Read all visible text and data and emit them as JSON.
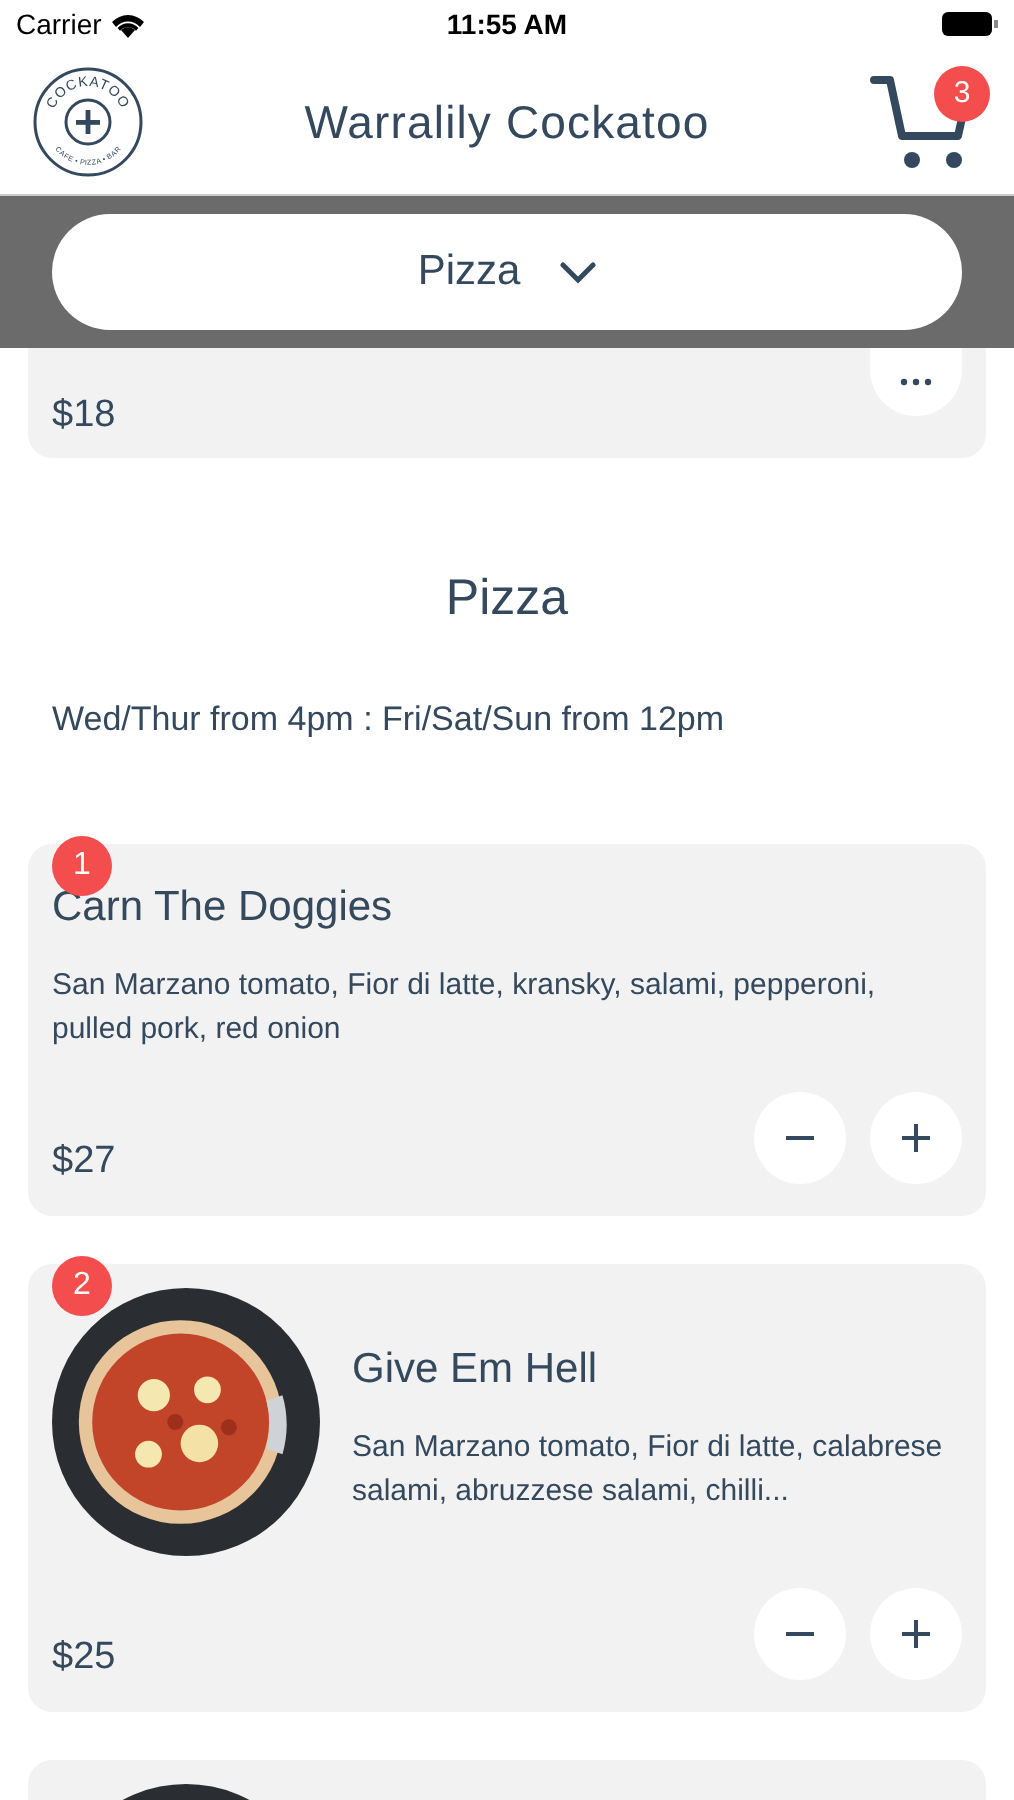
{
  "status_bar": {
    "carrier": "Carrier",
    "time": "11:55 AM"
  },
  "header": {
    "logo_top": "COCKATOO",
    "logo_bottom": "CAFE • PIZZA • BAR",
    "title": "Warralily Cockatoo",
    "cart_count": "3"
  },
  "category_picker": {
    "value": "Pizza"
  },
  "previous_item": {
    "price": "$18"
  },
  "section": {
    "title": "Pizza",
    "hours": "Wed/Thur from 4pm : Fri/Sat/Sun from 12pm"
  },
  "items": [
    {
      "kind": "full",
      "quantity": "1",
      "image": false,
      "name": "Carn The Doggies",
      "description": "San Marzano tomato, Fior di latte, kransky, salami, pepperoni, pulled pork, red onion",
      "price": "$27"
    },
    {
      "kind": "full",
      "quantity": "2",
      "image": true,
      "name": "Give Em Hell",
      "description": "San Marzano tomato, Fior di latte, calabrese salami, abruzzese salami, chilli...",
      "price": "$25"
    },
    {
      "kind": "cut",
      "image": true
    }
  ]
}
